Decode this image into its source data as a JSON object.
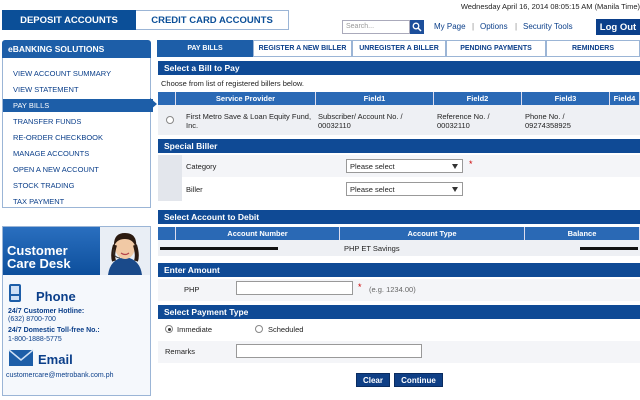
{
  "top": {
    "tab_deposit": "DEPOSIT ACCOUNTS",
    "tab_credit": "CREDIT CARD ACCOUNTS",
    "datetime": "Wednesday April 16, 2014 08:05:15 AM (Manila Time)",
    "search_placeholder": "Search...",
    "links": [
      "My Page",
      "Options",
      "Security Tools"
    ],
    "logout": "Log Out"
  },
  "sidebar": {
    "title": "eBANKING SOLUTIONS",
    "items": [
      {
        "label": "VIEW ACCOUNT SUMMARY",
        "active": false
      },
      {
        "label": "VIEW STATEMENT",
        "active": false
      },
      {
        "label": "PAY BILLS",
        "active": true
      },
      {
        "label": "TRANSFER FUNDS",
        "active": false
      },
      {
        "label": "RE-ORDER CHECKBOOK",
        "active": false
      },
      {
        "label": "MANAGE ACCOUNTS",
        "active": false
      },
      {
        "label": "OPEN A NEW ACCOUNT",
        "active": false
      },
      {
        "label": "STOCK TRADING",
        "active": false
      },
      {
        "label": "TAX PAYMENT",
        "active": false
      }
    ]
  },
  "care": {
    "title": "Customer Care Desk",
    "phone_label": "Phone",
    "hotline_label": "24/7 Customer Hotline:",
    "hotline_number": "(632) 8700-700",
    "tollfree_label": "24/7 Domestic Toll-free No.:",
    "tollfree_number": "1-800-1888-5775",
    "email_label": "Email",
    "email": "customercare@metrobank.com.ph"
  },
  "tabs": [
    "PAY BILLS",
    "REGISTER A NEW BILLER",
    "UNREGISTER A BILLER",
    "PENDING PAYMENTS",
    "REMINDERS"
  ],
  "bill": {
    "header": "Select a Bill to Pay",
    "instruction": "Choose from list of registered billers below.",
    "columns": [
      "Service Provider",
      "Field1",
      "Field2",
      "Field3",
      "Field4"
    ],
    "row": {
      "provider": "First Metro Save & Loan Equity Fund, Inc.",
      "field1": "Subscriber/ Account No. / 00032110",
      "field2": "Reference No. / 00032110",
      "field3": "Phone No. / 09274358925",
      "field4": ""
    }
  },
  "special": {
    "header": "Special Biller",
    "category_label": "Category",
    "category_value": "Please select",
    "biller_label": "Biller",
    "biller_value": "Please select"
  },
  "debit": {
    "header": "Select Account to Debit",
    "columns": [
      "Account Number",
      "Account Type",
      "Balance"
    ],
    "row": {
      "account_type": "PHP ET Savings"
    }
  },
  "amount": {
    "header": "Enter Amount",
    "currency": "PHP",
    "hint": "(e.g. 1234.00)"
  },
  "payment": {
    "header": "Select Payment Type",
    "option_immediate": "Immediate",
    "option_scheduled": "Scheduled",
    "remarks_label": "Remarks"
  },
  "buttons": {
    "clear": "Clear",
    "continue": "Continue"
  }
}
